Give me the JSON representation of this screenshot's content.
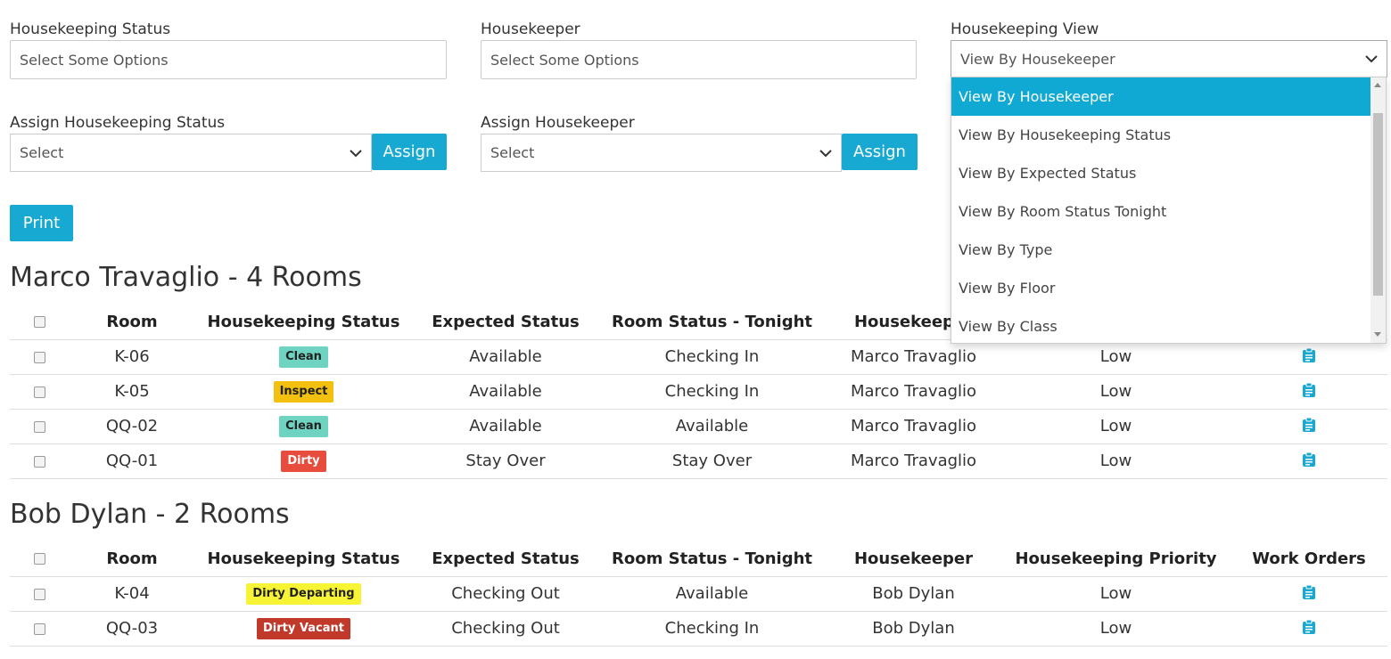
{
  "filters": {
    "housekeeping_status": {
      "label": "Housekeeping Status",
      "placeholder": "Select Some Options"
    },
    "housekeeper": {
      "label": "Housekeeper",
      "placeholder": "Select Some Options"
    },
    "housekeeping_view": {
      "label": "Housekeeping View",
      "value": "View By Housekeeper",
      "options": [
        "View By Housekeeper",
        "View By Housekeeping Status",
        "View By Expected Status",
        "View By Room Status Tonight",
        "View By Type",
        "View By Floor",
        "View By Class"
      ]
    }
  },
  "assign": {
    "status": {
      "label": "Assign Housekeeping Status",
      "value": "Select",
      "button": "Assign"
    },
    "housekeeper": {
      "label": "Assign Housekeeper",
      "value": "Select",
      "button": "Assign"
    }
  },
  "print_label": "Print",
  "columns": [
    "Room",
    "Housekeeping Status",
    "Expected Status",
    "Room Status - Tonight",
    "Housekeeper",
    "Housekeeping Priority",
    "Work Orders"
  ],
  "groups": [
    {
      "title": "Marco Travaglio - 4 Rooms",
      "rows": [
        {
          "room": "K-06",
          "status": "Clean",
          "expected": "Available",
          "tonight": "Checking In",
          "housekeeper": "Marco Travaglio",
          "priority": "Low"
        },
        {
          "room": "K-05",
          "status": "Inspect",
          "expected": "Available",
          "tonight": "Checking In",
          "housekeeper": "Marco Travaglio",
          "priority": "Low"
        },
        {
          "room": "QQ-02",
          "status": "Clean",
          "expected": "Available",
          "tonight": "Available",
          "housekeeper": "Marco Travaglio",
          "priority": "Low"
        },
        {
          "room": "QQ-01",
          "status": "Dirty",
          "expected": "Stay Over",
          "tonight": "Stay Over",
          "housekeeper": "Marco Travaglio",
          "priority": "Low"
        }
      ]
    },
    {
      "title": "Bob Dylan - 2 Rooms",
      "rows": [
        {
          "room": "K-04",
          "status": "Dirty Departing",
          "expected": "Checking Out",
          "tonight": "Available",
          "housekeeper": "Bob Dylan",
          "priority": "Low"
        },
        {
          "room": "QQ-03",
          "status": "Dirty Vacant",
          "expected": "Checking Out",
          "tonight": "Checking In",
          "housekeeper": "Bob Dylan",
          "priority": "Low"
        }
      ]
    }
  ],
  "status_colors": {
    "Clean": {
      "bg": "#6fd3c2",
      "fg": "#222222"
    },
    "Inspect": {
      "bg": "#f2c10f",
      "fg": "#222222"
    },
    "Dirty": {
      "bg": "#e74c3c",
      "fg": "#ffffff"
    },
    "Dirty Departing": {
      "bg": "#f7f435",
      "fg": "#222222"
    },
    "Dirty Vacant": {
      "bg": "#c0392b",
      "fg": "#ffffff"
    }
  },
  "accent_color": "#17a9d1",
  "icons": {
    "dropdown": "chevron-down-icon",
    "work_order": "clipboard-icon"
  }
}
